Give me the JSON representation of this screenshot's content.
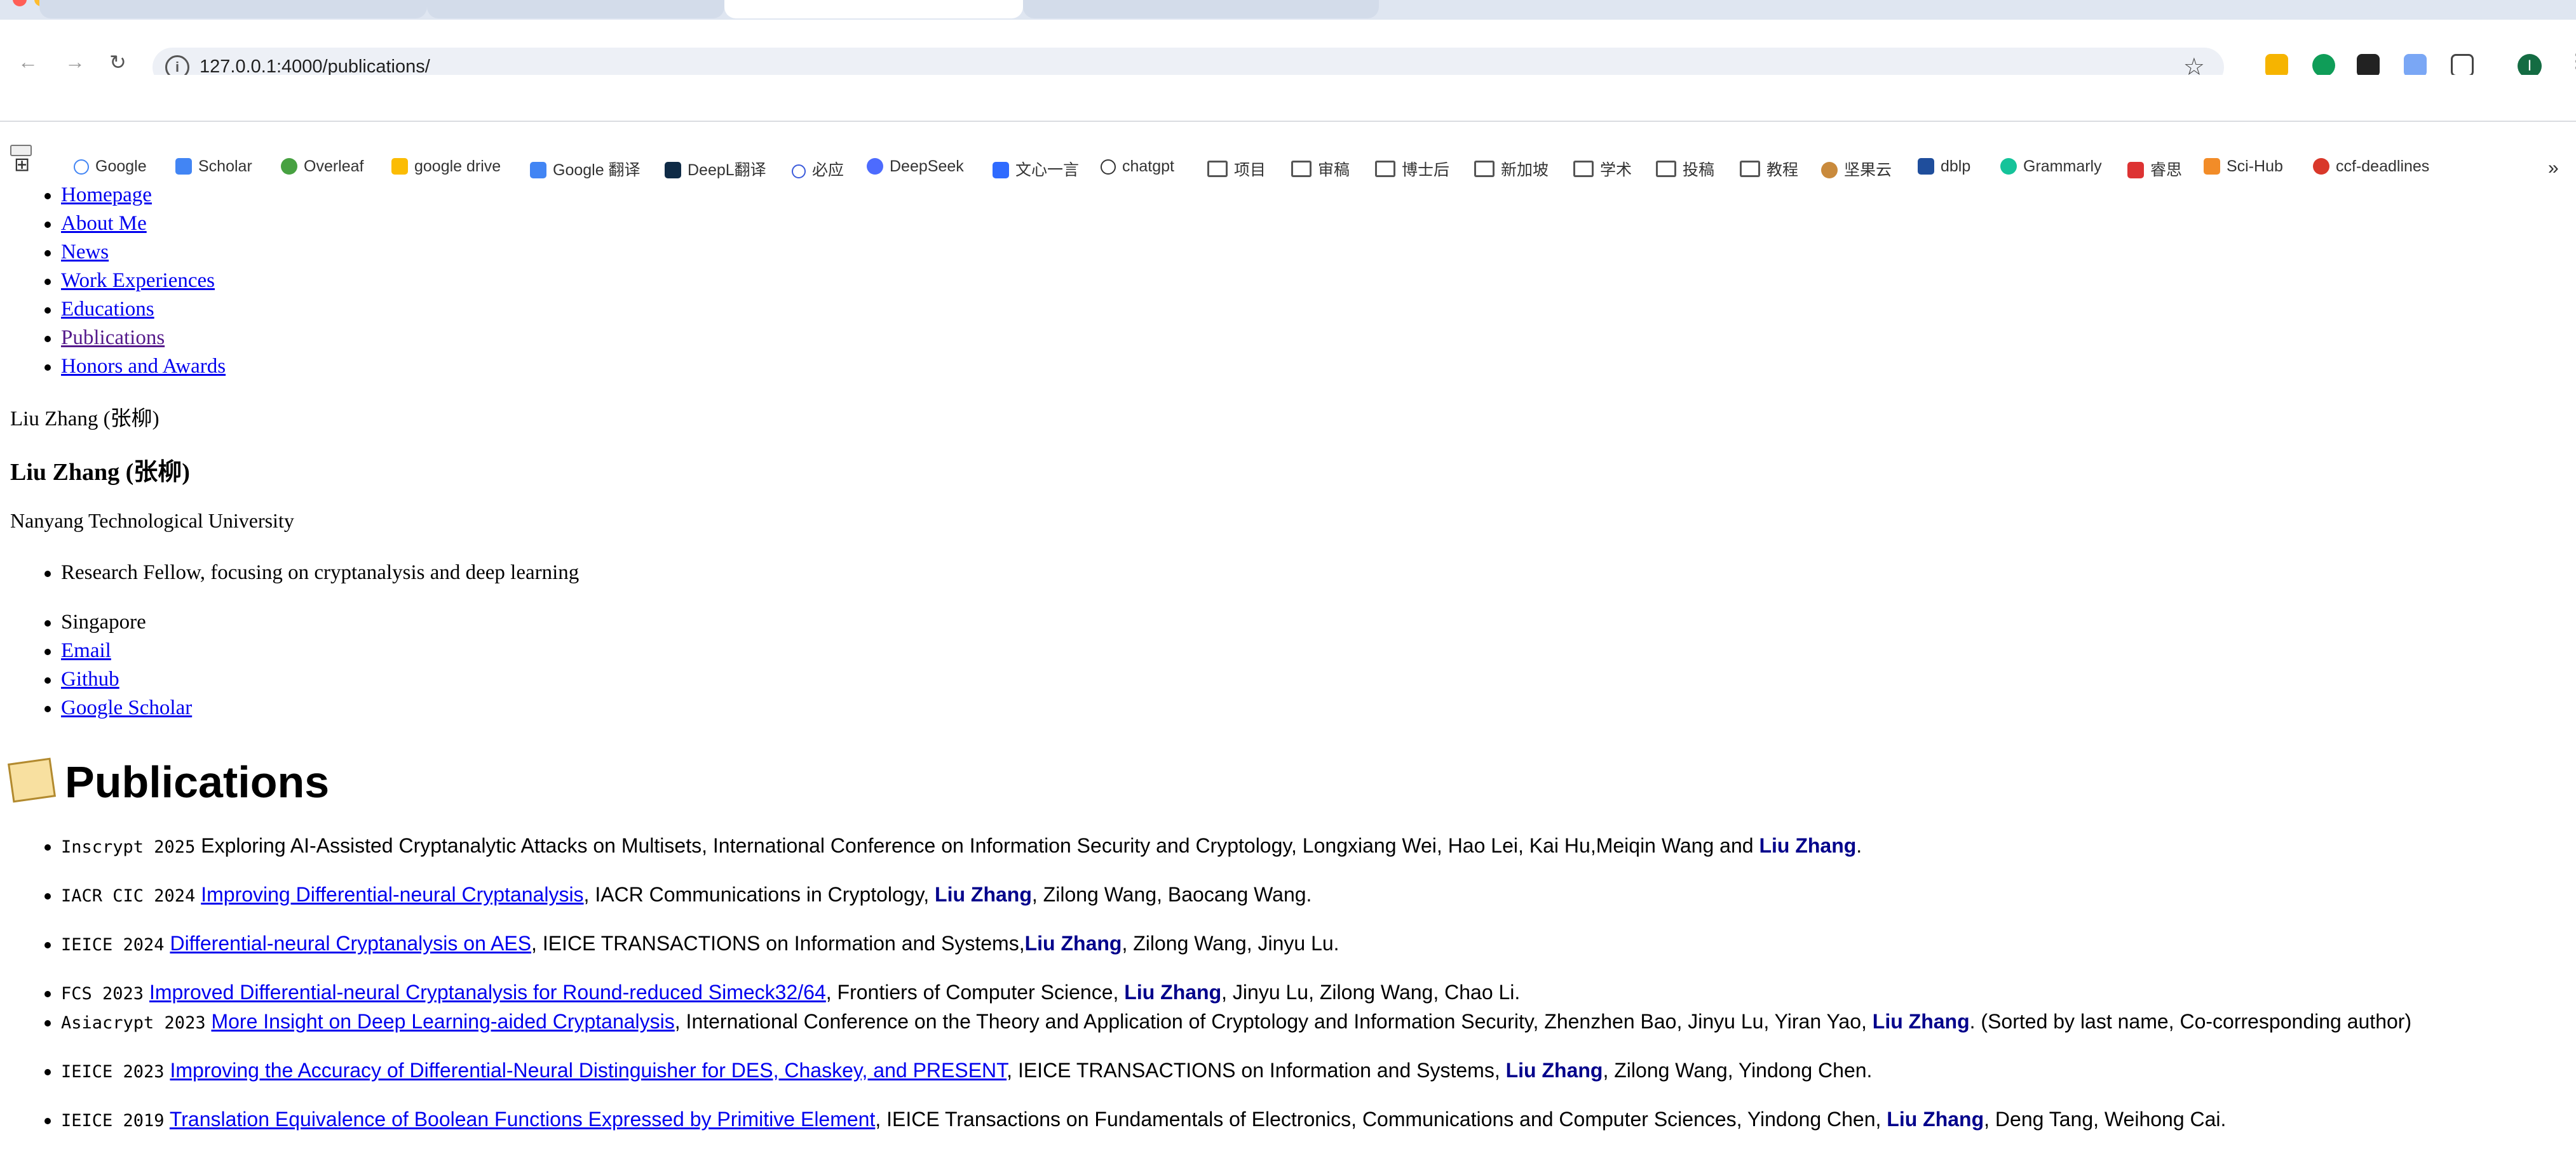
{
  "browser": {
    "url": "127.0.0.1:4000/publications/",
    "bookmarks": [
      "Google",
      "Scholar",
      "Overleaf",
      "google drive",
      "Google 翻译",
      "DeepL翻译",
      "必应",
      "DeepSeek",
      "文心一言",
      "chatgpt",
      "项目",
      "审稿",
      "博士后",
      "新加坡",
      "学术",
      "投稿",
      "教程",
      "坚果云",
      "dblp",
      "Grammarly",
      "睿思",
      "Sci-Hub",
      "ccf-deadlines"
    ],
    "avatar_letter": "I"
  },
  "nav": {
    "items": [
      "Homepage",
      "About Me",
      "News",
      "Work Experiences",
      "Educations",
      "Publications",
      "Honors and Awards"
    ]
  },
  "profile": {
    "image_alt": "Liu Zhang (张柳)",
    "name": "Liu Zhang (张柳)",
    "affiliation": "Nanyang Technological University",
    "bio": "Research Fellow, focusing on cryptanalysis and deep learning",
    "links": [
      "Singapore",
      "Email",
      "Github",
      "Google Scholar"
    ]
  },
  "publications_title": "Publications",
  "publications": [
    {
      "venue": "Inscrypt 2025",
      "title": "Exploring AI-Assisted Cryptanalytic Attacks on Multisets",
      "rest": ", International Conference on Information Security and Cryptology, Longxiang Wei, Hao Lei, Kai Hu,Meiqin Wang and ",
      "me": "Liu Zhang",
      "after": "."
    },
    {
      "venue": "IACR CIC 2024",
      "title": "Improving Differential-neural Cryptanalysis",
      "rest": ", IACR Communications in Cryptology, ",
      "me": "Liu Zhang",
      "after": ", Zilong Wang, Baocang Wang."
    },
    {
      "venue": "IEICE 2024",
      "title": "Differential-neural Cryptanalysis on AES",
      "rest": ", IEICE TRANSACTIONS on Information and Systems,",
      "me": "Liu Zhang",
      "after": ", Zilong Wang, Jinyu Lu."
    },
    {
      "venue": "FCS 2023",
      "title": "Improved Differential-neural Cryptanalysis for Round-reduced Simeck32/64",
      "rest": ", Frontiers of Computer Science, ",
      "me": "Liu Zhang",
      "after": ", Jinyu Lu, Zilong Wang, Chao Li."
    },
    {
      "venue": "Asiacrypt 2023",
      "title": "More Insight on Deep Learning-aided Cryptanalysis",
      "rest": ", International Conference on the Theory and Application of Cryptology and Information Security, Zhenzhen Bao, Jinyu Lu, Yiran Yao, ",
      "me": "Liu Zhang",
      "after": ". (Sorted by last name, Co-corresponding author)"
    },
    {
      "venue": "IEICE 2023",
      "title": "Improving the Accuracy of Differential-Neural Distinguisher for DES, Chaskey, and PRESENT",
      "rest": ", IEICE TRANSACTIONS on Information and Systems, ",
      "me": "Liu Zhang",
      "after": ", Zilong Wang, Yindong Chen."
    },
    {
      "venue": "IEICE 2019",
      "title": "Translation Equivalence of Boolean Functions Expressed by Primitive Element",
      "rest": ", IEICE Transactions on Fundamentals of Electronics, Communications and Computer Sciences, Yindong Chen, ",
      "me": "Liu Zhang",
      "after": ", Deng Tang, Weihong Cai."
    }
  ]
}
